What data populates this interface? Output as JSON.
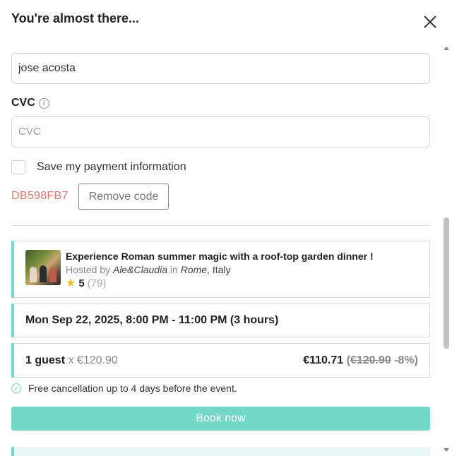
{
  "header": {
    "title": "You're almost there..."
  },
  "payment": {
    "cardholder_value": "jose acosta",
    "cvc_label": "CVC",
    "cvc_placeholder": "CVC",
    "save_label": "Save my payment information"
  },
  "promo": {
    "code": "DB598FB7",
    "remove_label": "Remove code"
  },
  "experience": {
    "title": "Experience Roman summer magic with a roof-top garden dinner !",
    "hosted_prefix": "Hosted by",
    "host": "Ale&Claudia",
    "in_word": "in",
    "city": "Rome",
    "country": ", Italy",
    "rating": "5",
    "review_count": "(79)"
  },
  "booking": {
    "datetime": "Mon Sep 22, 2025, 8:00 PM - 11:00 PM (3 hours)",
    "guests": "1 guest",
    "unit_price": "x €120.90",
    "total": "€110.71",
    "original_price": "€120.90",
    "discount": "-8%)",
    "open_paren": "("
  },
  "cancellation": {
    "text": "Free cancellation up to 4 days before the event."
  },
  "actions": {
    "book_label": "Book now"
  },
  "colors": {
    "accent": "#74d8c7",
    "promo": "#e4776a",
    "star": "#f5b921"
  },
  "icons": [
    "close-icon",
    "info-icon",
    "star-icon",
    "check-circle-icon",
    "experience-photo"
  ]
}
